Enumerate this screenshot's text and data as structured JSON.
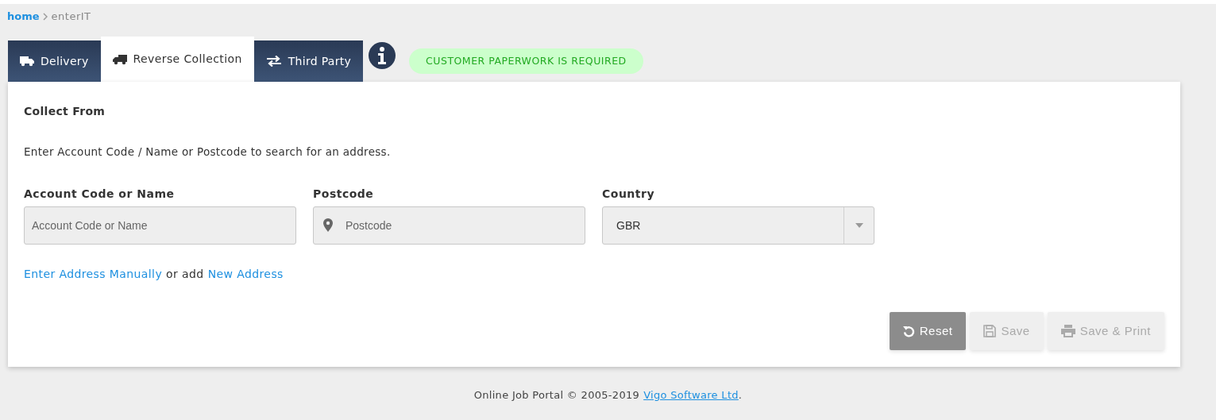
{
  "breadcrumb": {
    "link": "home",
    "current": "enterIT"
  },
  "tabs": [
    {
      "label": "Delivery",
      "kind": "delivery",
      "selected": false
    },
    {
      "label": "Reverse Collection",
      "kind": "collection",
      "selected": true
    },
    {
      "label": "Third Party",
      "kind": "transfer",
      "selected": false
    }
  ],
  "notice": "CUSTOMER PAPERWORK IS REQUIRED",
  "section_title": "Collect From",
  "instructions": "Enter Account Code / Name or Postcode to search for an address.",
  "fields": [
    {
      "label": "Account Code or Name",
      "kind": "text",
      "placeholder": "Account Code or Name"
    },
    {
      "label": "Postcode",
      "kind": "location",
      "placeholder": "Postcode"
    },
    {
      "label": "Country",
      "kind": "select",
      "value": "GBR"
    }
  ],
  "address_links": {
    "manual": "Enter Address Manually",
    "joiner": "or add",
    "new": "New Address"
  },
  "buttons": [
    {
      "label": "Reset",
      "kind": "reset",
      "disabled": false
    },
    {
      "label": "Save",
      "kind": "save",
      "disabled": true
    },
    {
      "label": "Save & Print",
      "kind": "print",
      "disabled": true
    }
  ],
  "footer": {
    "text": "Online Job Portal © 2005-2019",
    "link": "Vigo Software Ltd",
    "end": "."
  }
}
